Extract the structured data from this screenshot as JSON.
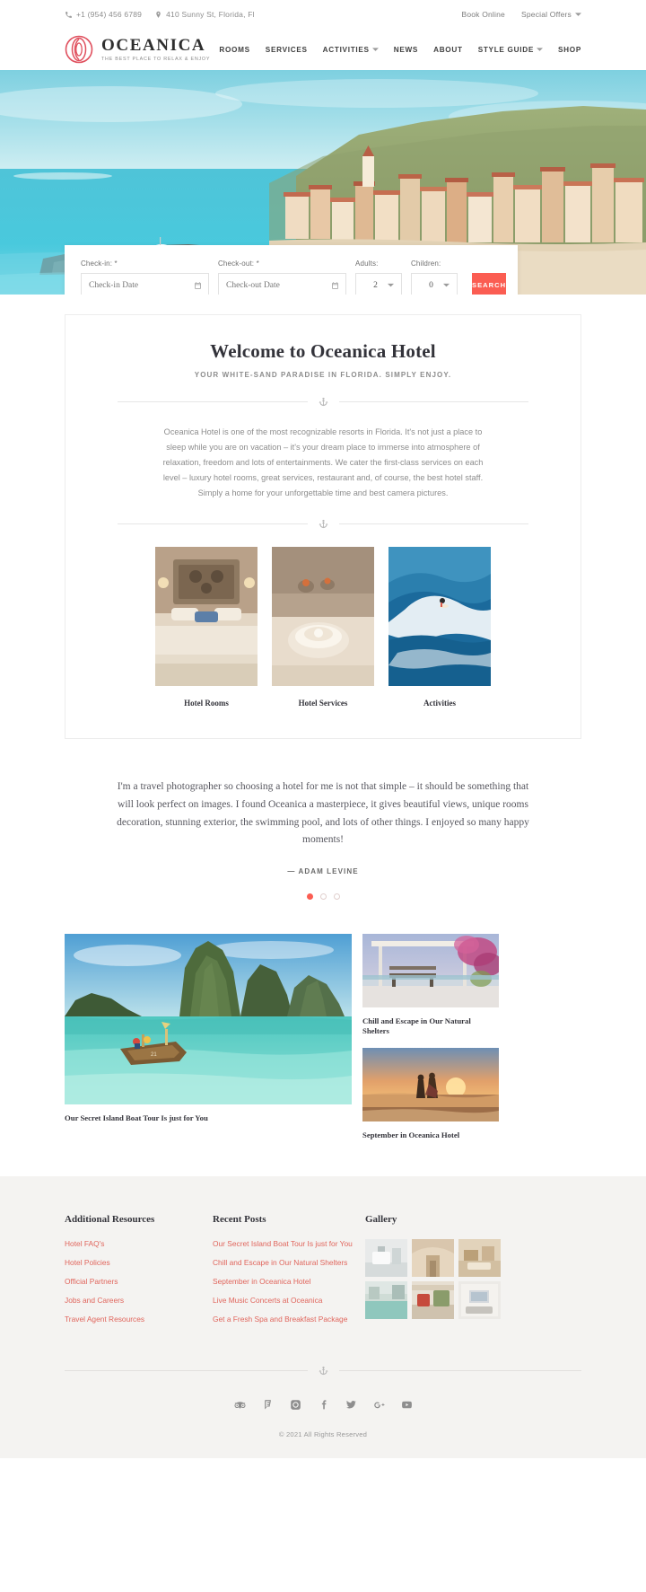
{
  "topbar": {
    "phone": "+1 (954) 456 6789",
    "address": "410 Sunny St, Florida, Fl",
    "book_online": "Book Online",
    "special_offers": "Special Offers"
  },
  "header": {
    "brand_name": "OCEANICA",
    "brand_tagline": "THE BEST PLACE TO RELAX & ENJOY",
    "nav": [
      {
        "label": "ROOMS",
        "has_caret": false
      },
      {
        "label": "SERVICES",
        "has_caret": false
      },
      {
        "label": "ACTIVITIES",
        "has_caret": true
      },
      {
        "label": "NEWS",
        "has_caret": false
      },
      {
        "label": "ABOUT",
        "has_caret": false
      },
      {
        "label": "STYLE GUIDE",
        "has_caret": true
      },
      {
        "label": "SHOP",
        "has_caret": false
      }
    ]
  },
  "booking": {
    "checkin_label": "Check-in:",
    "checkin_required": "*",
    "checkin_placeholder": "Check-in Date",
    "checkout_label": "Check-out:",
    "checkout_required": "*",
    "checkout_placeholder": "Check-out Date",
    "adults_label": "Adults:",
    "adults_value": "2",
    "children_label": "Children:",
    "children_value": "0",
    "search_label": "SEARCH",
    "accent_color": "#fb5d52"
  },
  "welcome": {
    "title": "Welcome to Oceanica Hotel",
    "subtitle": "YOUR WHITE-SAND PARADISE IN FLORIDA. SIMPLY ENJOY.",
    "body": "Oceanica Hotel is one of the most recognizable resorts in Florida. It's not just a place to sleep while you are on vacation – it's your dream place to immerse into atmosphere of relaxation, freedom and lots of entertainments. We cater the first-class services on each level – luxury hotel rooms, great services, restaurant and, of course, the best hotel staff. Simply a home for your unforgettable time and best camera pictures.",
    "cards": [
      {
        "title": "Hotel Rooms"
      },
      {
        "title": "Hotel Services"
      },
      {
        "title": "Activities"
      }
    ]
  },
  "testimonial": {
    "quote": "I'm a travel photographer so choosing a hotel for me is not that simple – it should be something that will look perfect on images. I found Oceanica a masterpiece, it gives beautiful views, unique rooms decoration, stunning exterior, the swimming pool, and lots of other things. I enjoyed so many happy moments!",
    "author": "— ADAM LEVINE",
    "slide_count": 3,
    "active_slide": 1
  },
  "posts": {
    "featured": {
      "title": "Our Secret Island Boat Tour Is just for You"
    },
    "side": [
      {
        "title": "Chill and Escape in Our Natural Shelters"
      },
      {
        "title": "September in Oceanica Hotel"
      }
    ]
  },
  "footer": {
    "col1": {
      "heading": "Additional Resources",
      "links": [
        "Hotel FAQ's",
        "Hotel Policies",
        "Official Partners",
        "Jobs and Careers",
        "Travel Agent Resources"
      ]
    },
    "col2": {
      "heading": "Recent Posts",
      "links": [
        "Our Secret Island Boat Tour Is just for You",
        "Chill and Escape in Our Natural Shelters",
        "September in Oceanica Hotel",
        "Live Music Concerts at Oceanica",
        "Get a Fresh Spa and Breakfast Package"
      ]
    },
    "col3": {
      "heading": "Gallery",
      "thumb_count": 6
    },
    "socials": [
      "tripadvisor-icon",
      "foursquare-icon",
      "instagram-icon",
      "facebook-icon",
      "twitter-icon",
      "google-plus-icon",
      "youtube-icon"
    ],
    "copyright": "© 2021 All Rights Reserved",
    "link_color": "#e0655c"
  }
}
